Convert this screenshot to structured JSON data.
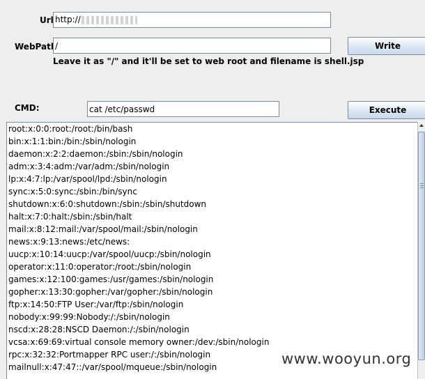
{
  "url": {
    "label": "Url:",
    "value": "http://"
  },
  "webpath": {
    "label": "WebPath:",
    "value": "/",
    "hint": "Leave it as \"/\" and it'll be set to web root and filename is shell.jsp"
  },
  "write_button": {
    "label": "Write"
  },
  "cmd": {
    "label": "CMD:",
    "value": "cat /etc/passwd"
  },
  "execute_button": {
    "label": "Execute"
  },
  "output": {
    "lines": [
      "root:x:0:0:root:/root:/bin/bash",
      "bin:x:1:1:bin:/bin:/sbin/nologin",
      "daemon:x:2:2:daemon:/sbin:/sbin/nologin",
      "adm:x:3:4:adm:/var/adm:/sbin/nologin",
      "lp:x:4:7:lp:/var/spool/lpd:/sbin/nologin",
      "sync:x:5:0:sync:/sbin:/bin/sync",
      "shutdown:x:6:0:shutdown:/sbin:/sbin/shutdown",
      "halt:x:7:0:halt:/sbin:/sbin/halt",
      "mail:x:8:12:mail:/var/spool/mail:/sbin/nologin",
      "news:x:9:13:news:/etc/news:",
      "uucp:x:10:14:uucp:/var/spool/uucp:/sbin/nologin",
      "operator:x:11:0:operator:/root:/sbin/nologin",
      "games:x:12:100:games:/usr/games:/sbin/nologin",
      "gopher:x:13:30:gopher:/var/gopher:/sbin/nologin",
      "ftp:x:14:50:FTP User:/var/ftp:/sbin/nologin",
      "nobody:x:99:99:Nobody:/:/sbin/nologin",
      "nscd:x:28:28:NSCD Daemon:/:/sbin/nologin",
      "vcsa:x:69:69:virtual console memory owner:/dev:/sbin/nologin",
      "rpc:x:32:32:Portmapper RPC user:/:/sbin/nologin",
      "mailnull:x:47:47::/var/spool/mqueue:/sbin/nologin"
    ]
  },
  "watermark": "www.wooyun.org"
}
